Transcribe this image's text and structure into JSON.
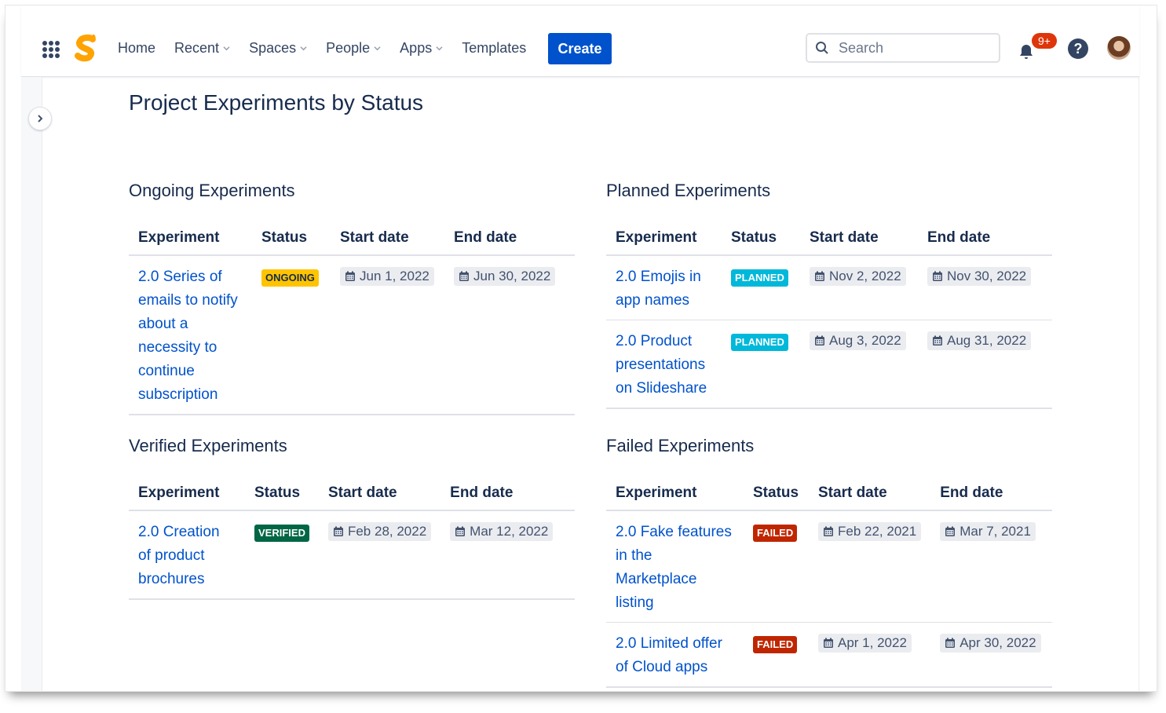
{
  "topbar": {
    "nav": [
      {
        "label": "Home",
        "dropdown": false
      },
      {
        "label": "Recent",
        "dropdown": true
      },
      {
        "label": "Spaces",
        "dropdown": true
      },
      {
        "label": "People",
        "dropdown": true
      },
      {
        "label": "Apps",
        "dropdown": true
      },
      {
        "label": "Templates",
        "dropdown": false
      }
    ],
    "create_label": "Create",
    "search_placeholder": "Search",
    "notification_count": "9+",
    "help_label": "?"
  },
  "colors": {
    "accent": "#0052cc",
    "ongoing": "#ffc400",
    "planned": "#00b8d9",
    "verified": "#006644",
    "failed": "#bf2600"
  },
  "page": {
    "title": "Project Experiments by Status"
  },
  "sections": [
    {
      "title": "Ongoing Experiments",
      "headers": [
        "Experiment",
        "Status",
        "Start date",
        "End date"
      ],
      "rows": [
        {
          "experiment": "2.0 Series of emails to notify about a necessity to continue subscription",
          "status": "ONGOING",
          "start": "Jun 1, 2022",
          "end": "Jun 30, 2022"
        }
      ]
    },
    {
      "title": "Planned Experiments",
      "headers": [
        "Experiment",
        "Status",
        "Start date",
        "End date"
      ],
      "rows": [
        {
          "experiment": "2.0 Emojis in app names",
          "status": "PLANNED",
          "start": "Nov 2, 2022",
          "end": "Nov 30, 2022"
        },
        {
          "experiment": "2.0 Product presentations on Slideshare",
          "status": "PLANNED",
          "start": "Aug 3, 2022",
          "end": "Aug 31, 2022"
        }
      ]
    },
    {
      "title": "Verified Experiments",
      "headers": [
        "Experiment",
        "Status",
        "Start date",
        "End date"
      ],
      "rows": [
        {
          "experiment": "2.0 Creation of product brochures",
          "status": "VERIFIED",
          "start": "Feb 28, 2022",
          "end": "Mar 12, 2022"
        }
      ]
    },
    {
      "title": "Failed Experiments",
      "headers": [
        "Experiment",
        "Status",
        "Start date",
        "End date"
      ],
      "rows": [
        {
          "experiment": "2.0 Fake features in the Marketplace listing",
          "status": "FAILED",
          "start": "Feb 22, 2021",
          "end": "Mar 7, 2021"
        },
        {
          "experiment": "2.0 Limited offer of Cloud apps",
          "status": "FAILED",
          "start": "Apr 1, 2022",
          "end": "Apr 30, 2022"
        }
      ]
    }
  ]
}
